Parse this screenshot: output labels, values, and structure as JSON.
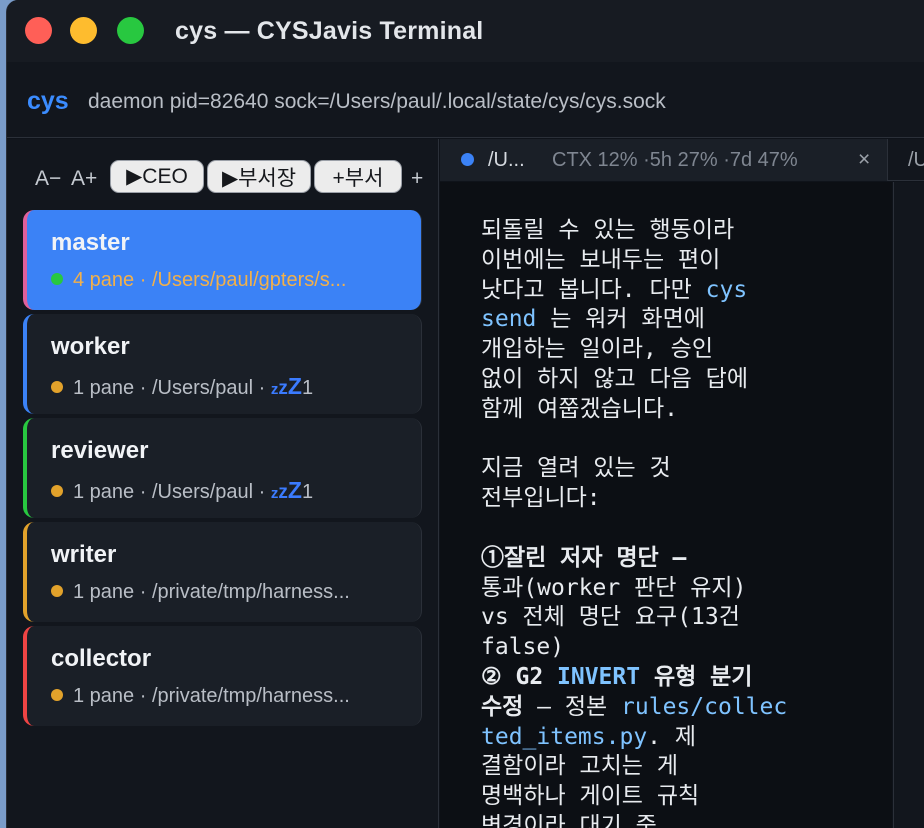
{
  "window": {
    "title": "cys — CYSJavis Terminal"
  },
  "daemon": {
    "brand": "cys",
    "info": "daemon pid=82640 sock=/Users/paul/.local/state/cys/cys.sock"
  },
  "toolbar": {
    "font_decrease": "A−",
    "font_increase": "A+",
    "ceo_button": "▶CEO",
    "vp_button": "▶부서장",
    "add_dept_button": "+부서",
    "add_button": "+"
  },
  "sessions": [
    {
      "name": "master",
      "meta": "4 pane · /Users/paul/gpters/s...",
      "active": true,
      "accent": "#e0609b",
      "dot": "#28c840"
    },
    {
      "name": "worker",
      "meta": "1 pane · /Users/paul · ",
      "idle_count": "1",
      "accent": "#3b82f6",
      "dot": "#e2a22b"
    },
    {
      "name": "reviewer",
      "meta": "1 pane · /Users/paul · ",
      "idle_count": "1",
      "accent": "#28c840",
      "dot": "#e2a22b"
    },
    {
      "name": "writer",
      "meta": "1 pane · /private/tmp/harness...",
      "accent": "#e2a22b",
      "dot": "#e2a22b"
    },
    {
      "name": "collector",
      "meta": "1 pane · /private/tmp/harness...",
      "accent": "#ef4444",
      "dot": "#e2a22b"
    }
  ],
  "tabs": {
    "active_label": "/U...",
    "active_stats": "CTX 12% ·5h 27% ·7d 47%",
    "close_glyph": "×",
    "second_label": "/U"
  },
  "terminal": {
    "l1": "되돌릴 수 있는 행동이라",
    "l2": "이번에는 보내두는 편이",
    "l3a": "낫다고 봅니다. 다만 ",
    "l3b": "cys",
    "l4a": "send",
    "l4b": " 는 워커 화면에",
    "l5": "개입하는 일이라, 승인",
    "l6": "없이 하지 않고 다음 답에",
    "l7": "함께 여쭙겠습니다.",
    "l9": "지금 열려 있는 것",
    "l10": "전부입니다:",
    "l12": "①잘린 저자 명단 —",
    "l13": "통과(worker 판단 유지)",
    "l14": "vs 전체 명단 요구(13건",
    "l15": "false)",
    "l16a": "② G2 ",
    "l16b": "INVERT",
    "l16c": " 유형 분기",
    "l17a": "수정",
    "l17b": " — 정본 ",
    "l17c": "rules/collec",
    "l18a": "ted_items.py",
    "l18b": ". 제",
    "l19": "결함이라 고치는 게",
    "l20": "명백하나 게이트 규칙",
    "l21": "변경이라 대기 중"
  }
}
